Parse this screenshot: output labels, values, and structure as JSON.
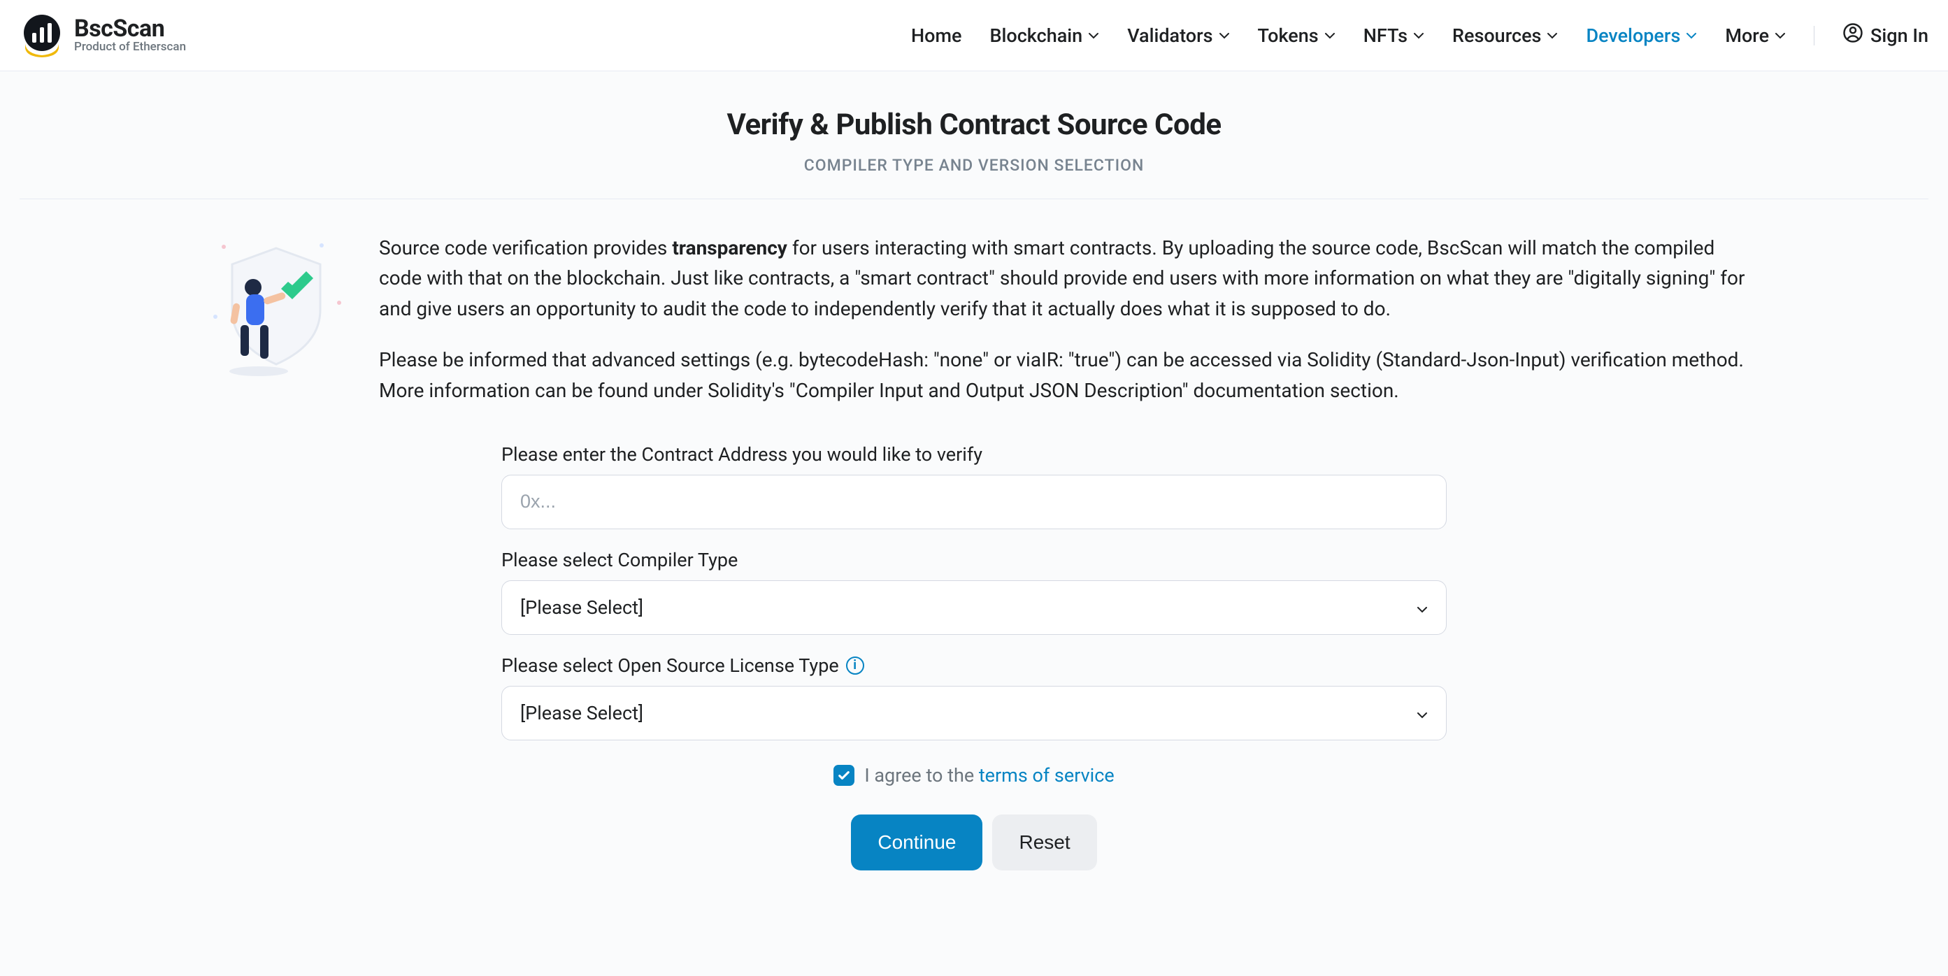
{
  "brand": {
    "name": "BscScan",
    "tagline": "Product of Etherscan"
  },
  "nav": {
    "items": [
      {
        "label": "Home",
        "has_dropdown": false
      },
      {
        "label": "Blockchain",
        "has_dropdown": true
      },
      {
        "label": "Validators",
        "has_dropdown": true
      },
      {
        "label": "Tokens",
        "has_dropdown": true
      },
      {
        "label": "NFTs",
        "has_dropdown": true
      },
      {
        "label": "Resources",
        "has_dropdown": true
      },
      {
        "label": "Developers",
        "has_dropdown": true,
        "active": true
      },
      {
        "label": "More",
        "has_dropdown": true
      }
    ],
    "signin": "Sign In"
  },
  "page": {
    "title": "Verify & Publish Contract Source Code",
    "subtitle": "COMPILER TYPE AND VERSION SELECTION"
  },
  "intro": {
    "p1_pre": "Source code verification provides ",
    "p1_bold": "transparency",
    "p1_post": " for users interacting with smart contracts. By uploading the source code, BscScan will match the compiled code with that on the blockchain. Just like contracts, a \"smart contract\" should provide end users with more information on what they are \"digitally signing\" for and give users an opportunity to audit the code to independently verify that it actually does what it is supposed to do.",
    "p2": "Please be informed that advanced settings (e.g. bytecodeHash: \"none\" or viaIR: \"true\") can be accessed via Solidity (Standard-Json-Input) verification method. More information can be found under Solidity's \"Compiler Input and Output JSON Description\" documentation section."
  },
  "form": {
    "address_label": "Please enter the Contract Address you would like to verify",
    "address_placeholder": "0x...",
    "address_value": "",
    "compiler_label": "Please select Compiler Type",
    "compiler_value": "[Please Select]",
    "license_label": "Please select Open Source License Type",
    "license_value": "[Please Select]",
    "agree_text": "I agree to the ",
    "tos_text": "terms of service",
    "agree_checked": true,
    "continue": "Continue",
    "reset": "Reset"
  }
}
